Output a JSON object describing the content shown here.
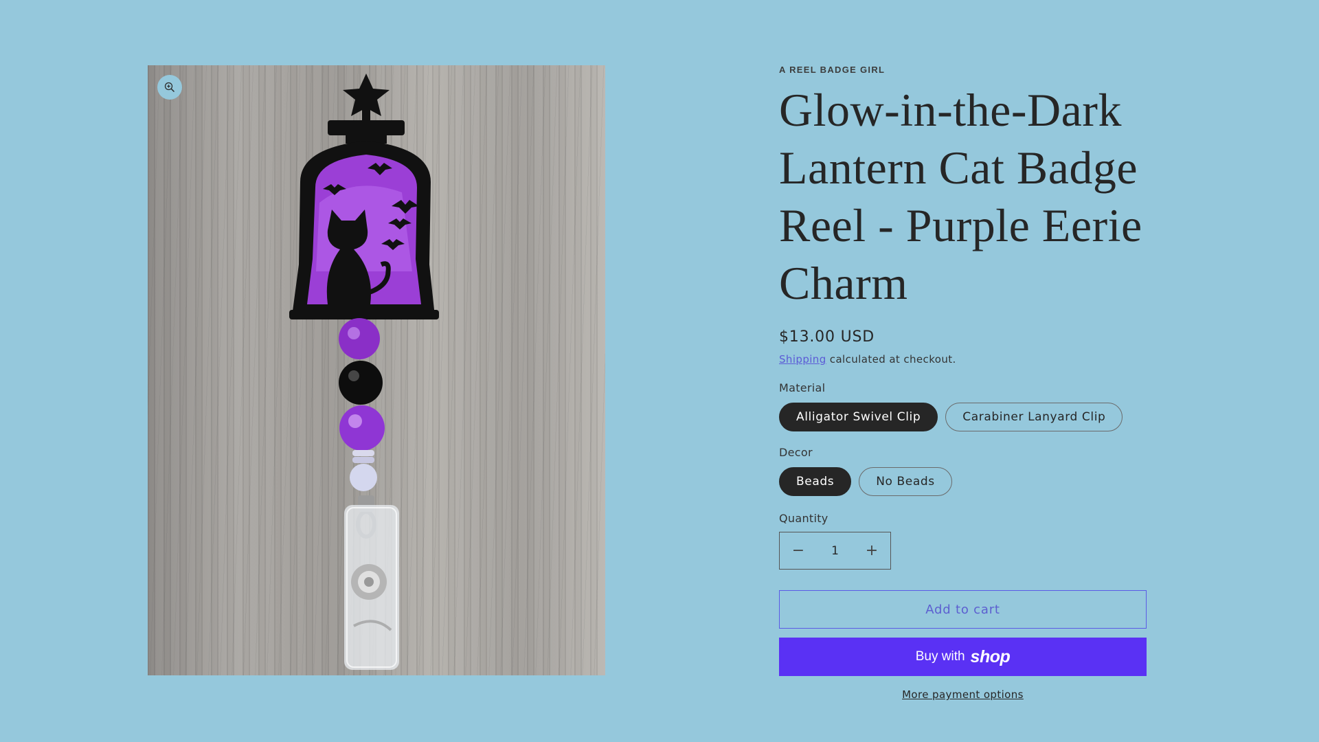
{
  "product": {
    "vendor": "A REEL BADGE GIRL",
    "title": "Glow-in-the-Dark Lantern Cat Badge Reel - Purple Eerie Charm",
    "price": "$13.00 USD",
    "shipping_link": "Shipping",
    "shipping_rest": " calculated at checkout."
  },
  "media": {
    "zoom_icon": "zoom-in-icon"
  },
  "options": {
    "material": {
      "label": "Material",
      "values": [
        "Alligator Swivel Clip",
        "Carabiner Lanyard Clip"
      ],
      "selected": "Alligator Swivel Clip"
    },
    "decor": {
      "label": "Decor",
      "values": [
        "Beads",
        "No Beads"
      ],
      "selected": "Beads"
    }
  },
  "quantity": {
    "label": "Quantity",
    "value": "1",
    "minus": "−",
    "plus": "+"
  },
  "actions": {
    "add_to_cart": "Add to cart",
    "buy_with": "Buy with",
    "shop_wordmark": "shop",
    "more_payment_options": "More payment options"
  },
  "colors": {
    "background": "#95c8dc",
    "shop_pay": "#5a31f4",
    "add_to_cart_accent": "#5a5ae6",
    "pill_active": "#262626",
    "shipping_link": "#5b5bd6"
  }
}
